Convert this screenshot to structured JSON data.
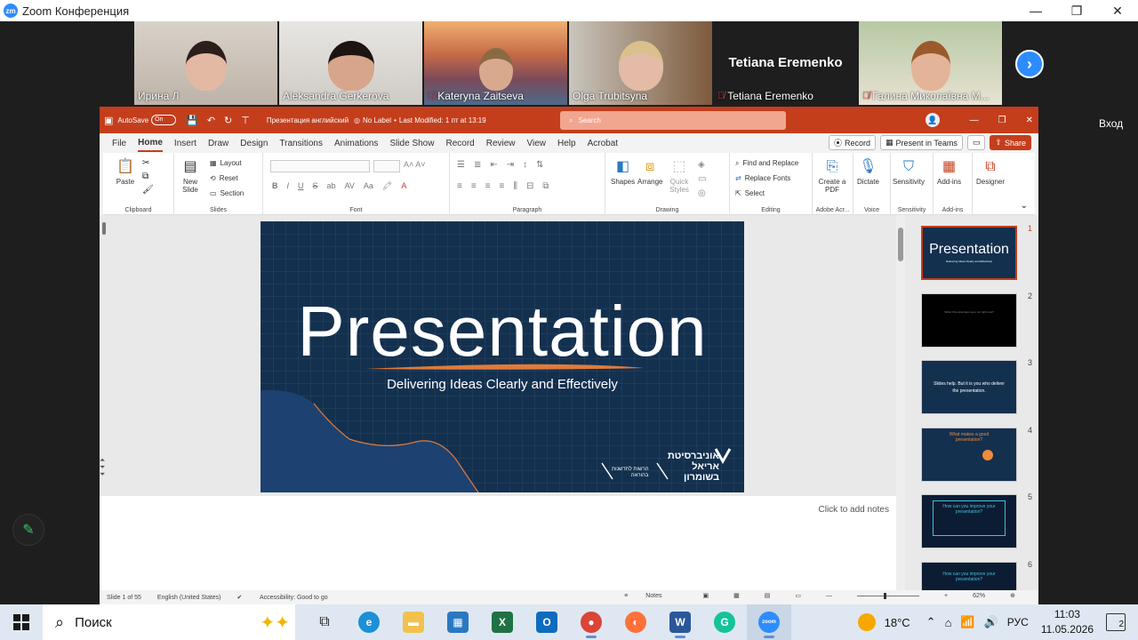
{
  "zoom": {
    "window_title": "Zoom Конференция",
    "logo_text": "zm",
    "vhod_label": "Вход",
    "participants": [
      {
        "name": "Ирина Л",
        "muted": false
      },
      {
        "name": "Aleksandra Gerkerova",
        "muted": false,
        "active": true
      },
      {
        "name": "Kateryna Zaitseva",
        "muted": true
      },
      {
        "name": "Olga Trubitsyna",
        "muted": false
      },
      {
        "name": "Tetiana Eremenko",
        "muted": true,
        "video_off": true,
        "display_name": "Tetiana Eremenko"
      },
      {
        "name": "Галина Миколаївна М...",
        "muted": true
      }
    ]
  },
  "ppt": {
    "autosave_label": "AutoSave",
    "autosave_state": "On",
    "doc_title": "Презентация английский",
    "label_text": "No Label",
    "last_modified": "Last Modified: 1 пт at 13:19",
    "search_placeholder": "Search",
    "menu": [
      "File",
      "Home",
      "Insert",
      "Draw",
      "Design",
      "Transitions",
      "Animations",
      "Slide Show",
      "Record",
      "Review",
      "View",
      "Help",
      "Acrobat"
    ],
    "record_btn": "Record",
    "teams_btn": "Present in Teams",
    "share_btn": "Share",
    "ribbon": {
      "paste": "Paste",
      "clipboard": "Clipboard",
      "new_slide": "New Slide",
      "layout": "Layout",
      "reset": "Reset",
      "section": "Section",
      "slides": "Slides",
      "font": "Font",
      "paragraph": "Paragraph",
      "shapes": "Shapes",
      "arrange": "Arrange",
      "quick_styles": "Quick Styles",
      "drawing": "Drawing",
      "find_replace": "Find and Replace",
      "replace_fonts": "Replace Fonts",
      "select": "Select",
      "editing": "Editing",
      "create_pdf": "Create a PDF",
      "adobe": "Adobe Acr...",
      "dictate": "Dictate",
      "voice": "Voice",
      "sensitivity": "Sensitivity",
      "sensitivity_grp": "Sensitivity",
      "addins": "Add-ins",
      "addins_grp": "Add-ins",
      "designer": "Designer"
    },
    "slide": {
      "title": "Presentation",
      "subtitle": "Delivering Ideas Clearly and Effectively",
      "logo_line1": "אוניברסיטת",
      "logo_line2": "אריאל",
      "logo_line3": "בשומרון",
      "small_line1": "הרשות לחדשנות",
      "small_line2": "בהוראה"
    },
    "notes_placeholder": "Click to add notes",
    "thumbnails": [
      {
        "num": "1",
        "text": "Presentation",
        "sub": "Delivering Ideas Clearly and Effectively"
      },
      {
        "num": "2",
        "text": "What if the attendees were not right now?"
      },
      {
        "num": "3",
        "text": "Slides help. But it is you who deliver the presentation."
      },
      {
        "num": "4",
        "text": "What makes a good presentation?"
      },
      {
        "num": "5",
        "text": "How can you improve your presentation?"
      },
      {
        "num": "6",
        "text": "How can you improve your presentation?"
      }
    ],
    "status": {
      "slide_of": "Slide 1 of 55",
      "language": "English (United States)",
      "accessibility": "Accessibility: Good to go",
      "notes": "Notes",
      "zoom": "62%"
    }
  },
  "taskbar": {
    "search_label": "Поиск",
    "temperature": "18°C",
    "lang": "РУС",
    "time": "11:03",
    "date": "11.05.2026",
    "notifications": "2"
  },
  "colors": {
    "ppt_accent": "#c43e1c",
    "slide_bg": "#13304f",
    "zoom_blue": "#2d8cff",
    "active_speaker": "#b8e65a"
  }
}
